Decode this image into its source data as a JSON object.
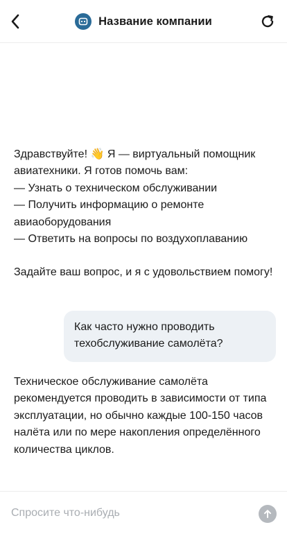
{
  "header": {
    "title": "Название компании",
    "back_icon": "chevron-left-icon",
    "refresh_icon": "refresh-icon",
    "avatar_icon": "bot-icon",
    "avatar_color": "#2a6b98"
  },
  "messages": {
    "bot_greeting": {
      "lines": [
        "Здравствуйте! 👋 Я — виртуальный помощник авиатехники. Я готов помочь вам:",
        "— Узнать о техническом обслуживании",
        "— Получить информацию о ремонте авиаоборудования",
        "— Ответить на вопросы по воздухоплаванию"
      ],
      "closing": "Задайте ваш вопрос, и я с удовольствием помогу!"
    },
    "user_question": "Как часто нужно проводить техобслуживание самолёта?",
    "bot_answer": "Техническое обслуживание самолёта рекомендуется проводить в зависимости от типа эксплуатации, но обычно каждые 100-150 часов налёта или по мере накопления определённого количества циклов."
  },
  "composer": {
    "placeholder": "Спросите что-нибудь",
    "value": "",
    "send_icon": "arrow-up-icon"
  },
  "colors": {
    "user_bubble": "#edf1f5",
    "send_button_disabled": "#b5b9be",
    "placeholder": "#a9adb2"
  }
}
